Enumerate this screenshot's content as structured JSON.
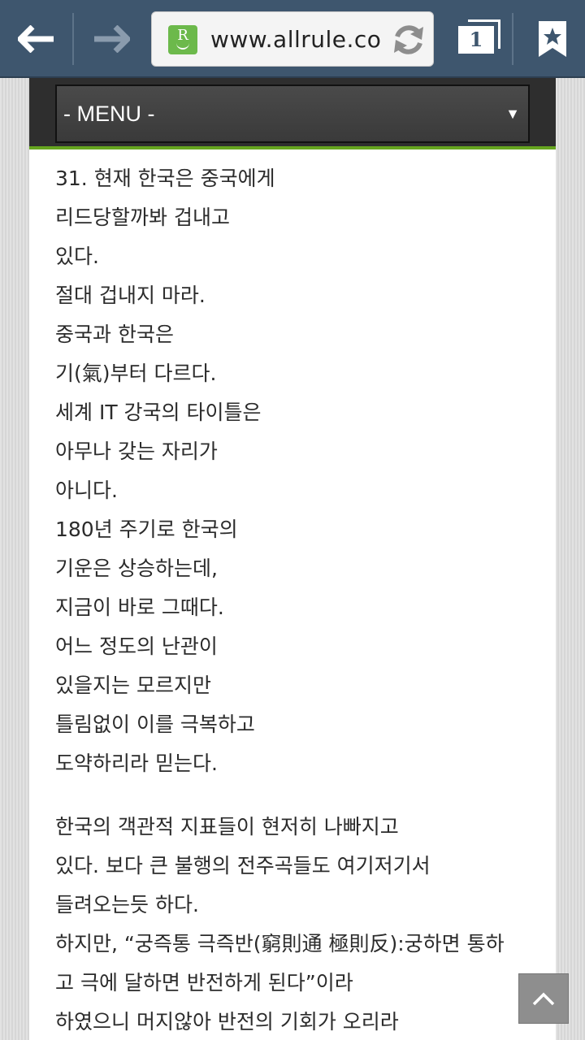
{
  "browser": {
    "url": "www.allrule.co",
    "tab_count": "1",
    "favicon_letter": "R",
    "colors": {
      "toolbar": "#3e566e",
      "favicon": "#6cb94b",
      "menu_accent": "#66a51f"
    },
    "icons": [
      "back-arrow-icon",
      "forward-arrow-icon",
      "refresh-icon",
      "tabs-icon",
      "bookmark-star-icon"
    ]
  },
  "menu": {
    "label": "- MENU -",
    "arrow": "▼"
  },
  "article": {
    "lines": [
      "31. 현재 한국은 중국에게",
      "리드당할까봐 겁내고",
      "있다.",
      "절대 겁내지 마라.",
      "중국과 한국은",
      "기(氣)부터 다르다.",
      "세계 IT 강국의 타이틀은",
      "아무나 갖는 자리가",
      "아니다.",
      "180년 주기로 한국의",
      "기운은 상승하는데,",
      "지금이 바로 그때다.",
      "어느 정도의 난관이",
      "있을지는 모르지만",
      "틀림없이 이를 극복하고",
      "도약하리라 믿는다."
    ],
    "lines2": [
      "한국의 객관적 지표들이 현저히 나빠지고",
      "있다. 보다 큰 불행의 전주곡들도 여기저기서",
      "들려오는듯 하다.",
      "하지만, “궁즉통 극즉반(窮則通 極則反):궁하면 통하",
      "고 극에 달하면 반전하게 된다”이라",
      "하였으니 머지않아 반전의 기회가 오리라"
    ]
  }
}
